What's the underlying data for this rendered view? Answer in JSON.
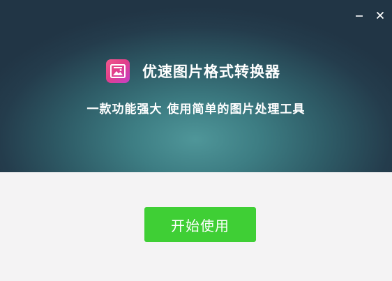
{
  "window": {
    "title_bar": {
      "minimize_icon": "minimize-icon",
      "close_icon": "close-icon"
    }
  },
  "header": {
    "app_icon": "image-icon",
    "app_name": "优速图片格式转换器",
    "tagline": "一款功能强大 使用简单的图片处理工具"
  },
  "main": {
    "start_button_label": "开始使用"
  },
  "colors": {
    "banner_dark": "#243c4c",
    "banner_center": "#4f9699",
    "body_background": "#f4f3f4",
    "primary_button": "#3fcf35",
    "logo_gradient_start": "#f15a8e",
    "logo_gradient_end": "#c53fc7"
  }
}
